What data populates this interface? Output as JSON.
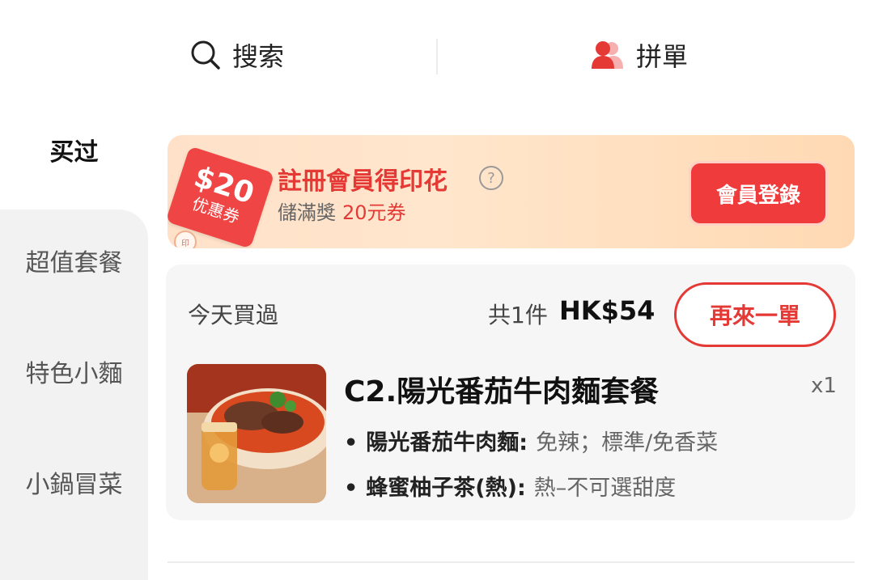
{
  "topbar": {
    "search_label": "搜索",
    "group_label": "拼單"
  },
  "sidebar": {
    "items": [
      {
        "label": "买过",
        "active": true
      },
      {
        "label": "超值套餐"
      },
      {
        "label": "特色小麵"
      },
      {
        "label": "小鍋冒菜"
      }
    ]
  },
  "banner": {
    "coupon_amount": "$20",
    "coupon_label": "优惠券",
    "title": "註冊會員得印花",
    "subtitle": "儲滿獎",
    "subtitle_accent": "20元券",
    "login_button": "會員登錄"
  },
  "order": {
    "date_label": "今天買過",
    "count_label": "共1件",
    "total_price": "HK$54",
    "reorder_button": "再來一單",
    "item": {
      "name": "C2.陽光番茄牛肉麵套餐",
      "qty": "x1",
      "options": [
        {
          "name": "陽光番茄牛肉麵:",
          "value": "免辣；標準/免香菜"
        },
        {
          "name": "蜂蜜柚子茶(熱):",
          "value": "熱–不可選甜度"
        }
      ]
    }
  },
  "colors": {
    "accent": "#e53935",
    "banner_bg": "#ffe1c9"
  }
}
